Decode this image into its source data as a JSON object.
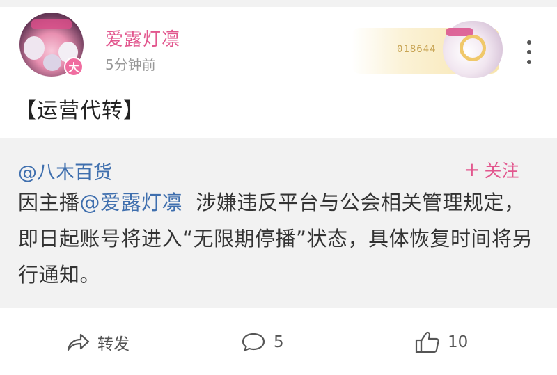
{
  "post": {
    "author": "爱露灯凛",
    "time": "5分钟前",
    "avatar_badge": "大",
    "deco_number": "018644",
    "text": "【运营代转】"
  },
  "repost": {
    "author": "@八木百货",
    "follow_label": "关注",
    "follow_plus": "+",
    "body_prefix": "因主播",
    "body_mention": "@爱露灯凛",
    "body_rest": "  涉嫌违反平台与公会相关管理规定，即日起账号将进入“无限期停播”状态，具体恢复时间将另行通知。"
  },
  "actions": {
    "repost_label": "转发",
    "comment_count": "5",
    "like_count": "10"
  },
  "colors": {
    "brand_pink": "#e2578e",
    "link_blue": "#3f6fae",
    "repost_bg": "#f2f2f2"
  },
  "icons": [
    "more-icon",
    "repost-icon",
    "comment-icon",
    "like-icon"
  ]
}
